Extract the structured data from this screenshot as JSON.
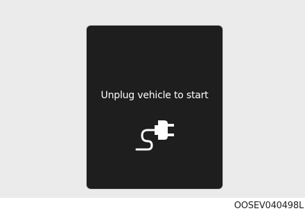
{
  "display": {
    "message": "Unplug vehicle to start",
    "icon": "unplug-connector-icon"
  },
  "figure": {
    "code": "OOSEV040498L"
  },
  "colors": {
    "display_bg": "#1e1e1e",
    "page_bg": "#ebebeb",
    "text": "#ffffff"
  }
}
